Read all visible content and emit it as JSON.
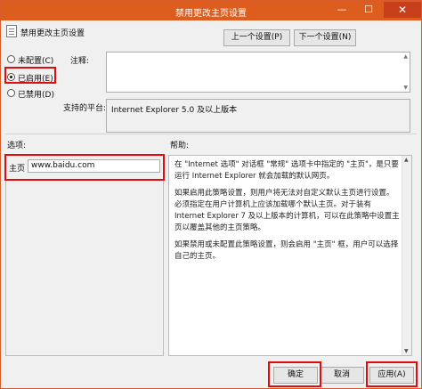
{
  "window": {
    "title": "禁用更改主页设置",
    "minimize": "—",
    "maximize": "☐",
    "close": "✕"
  },
  "policy": {
    "name": "禁用更改主页设置"
  },
  "nav": {
    "prev_label": "上一个设置(P)",
    "next_label": "下一个设置(N)"
  },
  "state": {
    "options": [
      {
        "label": "未配置(C)",
        "checked": false
      },
      {
        "label": "已启用(E)",
        "checked": true
      },
      {
        "label": "已禁用(D)",
        "checked": false
      }
    ]
  },
  "comment": {
    "label": "注释:",
    "value": ""
  },
  "platform": {
    "label": "支持的平台:",
    "value": "Internet Explorer 5.0 及以上版本"
  },
  "options_section": {
    "label": "选项:",
    "homepage_label": "主页",
    "homepage_value": "www.baidu.com"
  },
  "help": {
    "label": "帮助:",
    "paragraphs": [
      "在 \"Internet 选项\" 对话框 \"常规\" 选项卡中指定的 \"主页\"，是只要运行 Internet Explorer 就会加载的默认网页。",
      "如果启用此策略设置，则用户将无法对自定义默认主页进行设置。必须指定在用户计算机上应该加载哪个默认主页。对于装有 Internet Explorer 7 及以上版本的计算机，可以在此策略中设置主页以覆盖其他的主页策略。",
      "如果禁用或未配置此策略设置，则会启用 \"主页\" 框，用户可以选择自己的主页。"
    ]
  },
  "footer": {
    "ok_label": "确定",
    "cancel_label": "取消",
    "apply_label": "应用(A)"
  },
  "colors": {
    "titlebar": "#dc5d1d",
    "highlight": "#e30b0b",
    "dialog_bg": "#f0f0f0"
  }
}
